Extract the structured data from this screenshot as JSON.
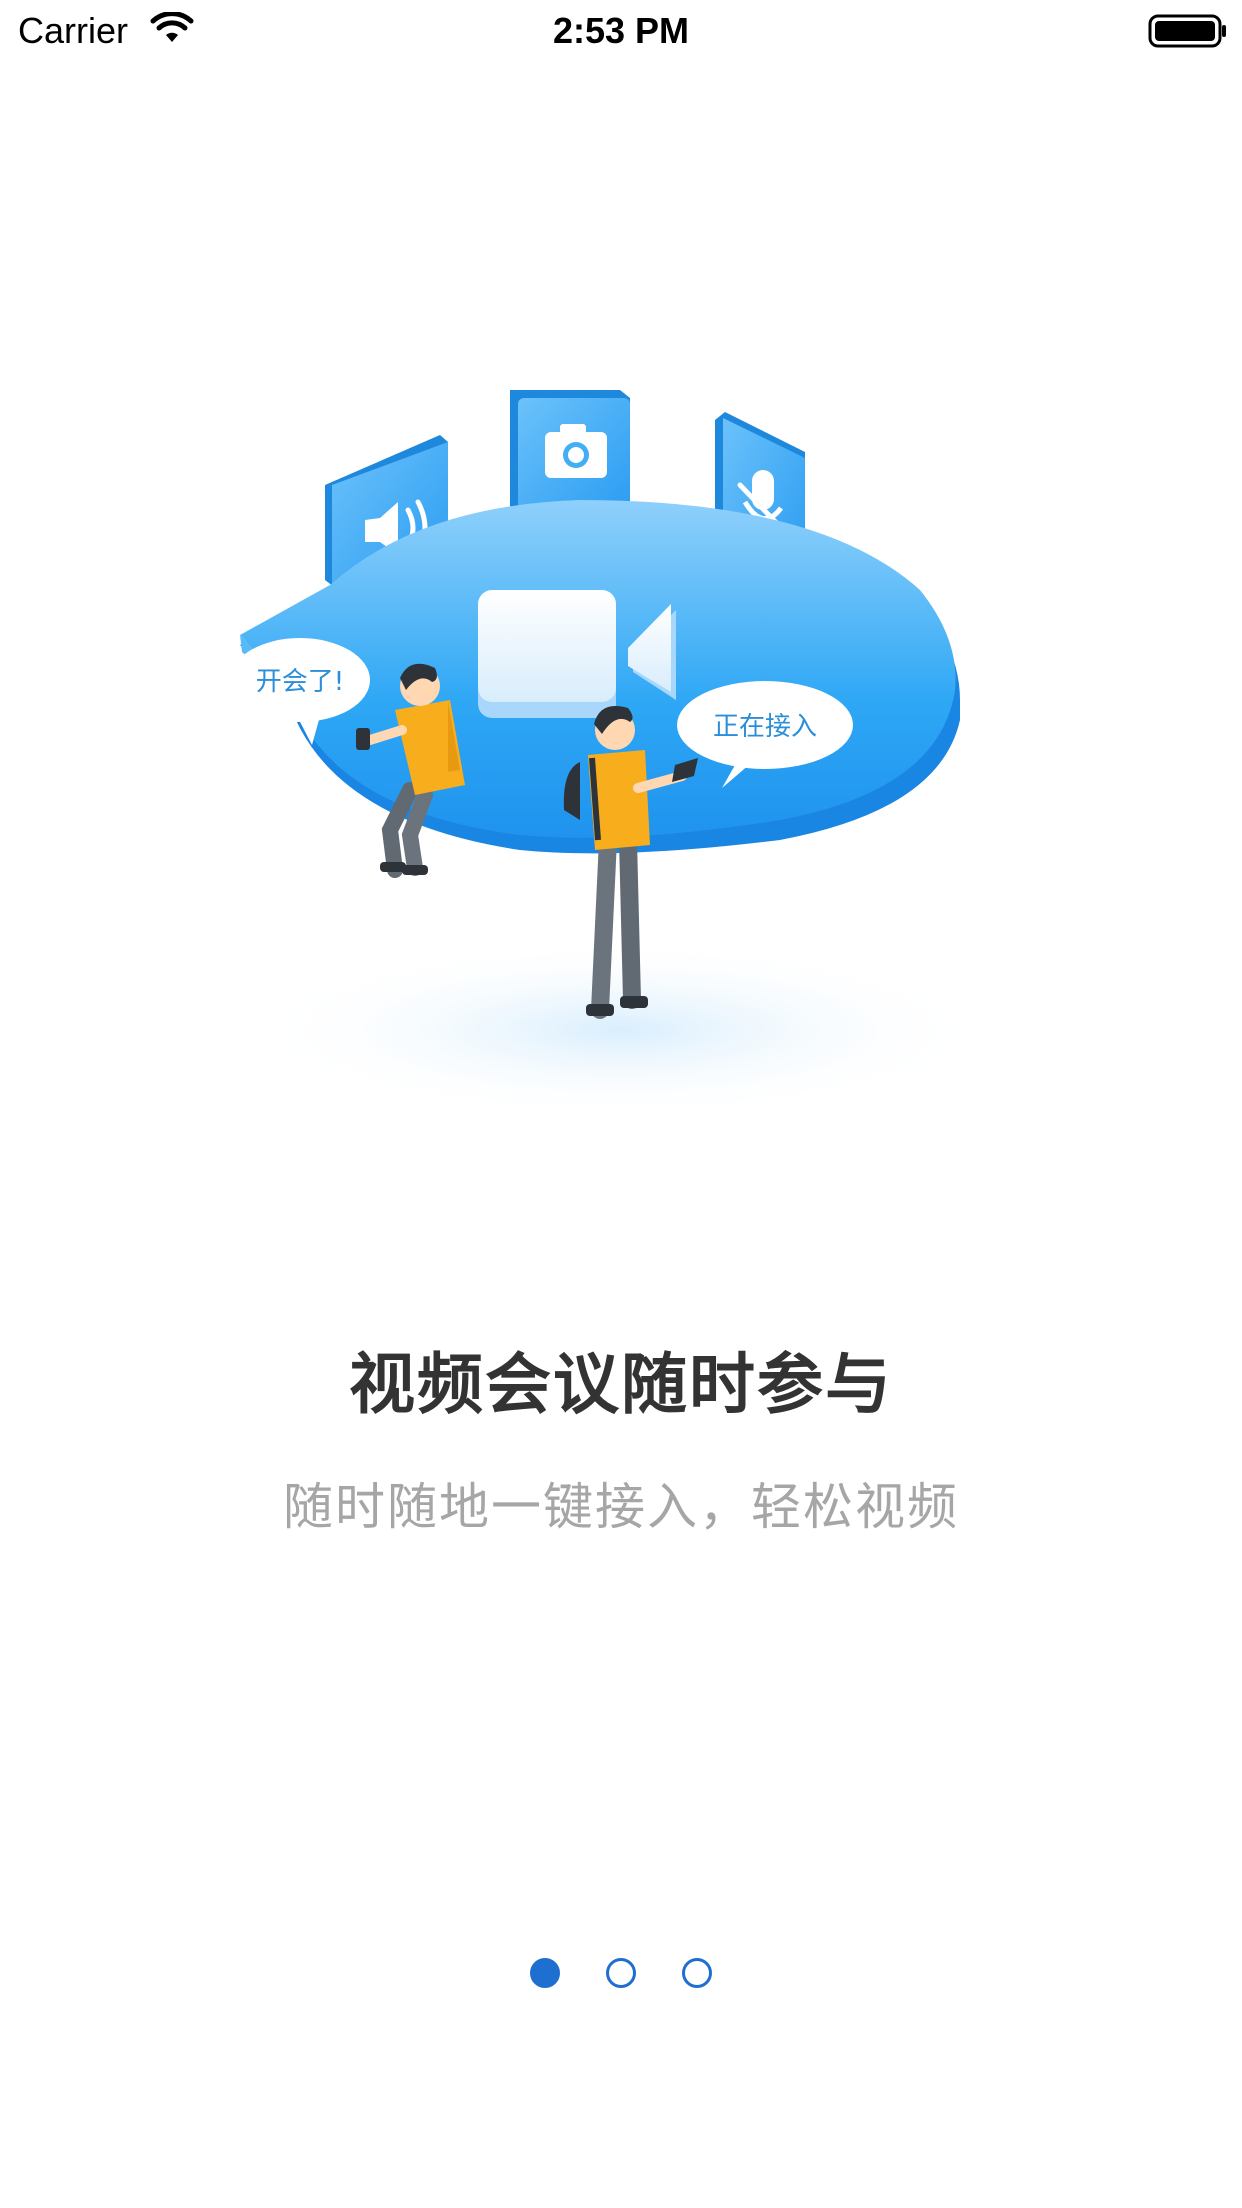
{
  "status_bar": {
    "carrier": "Carrier",
    "time": "2:53 PM",
    "wifi_icon": "wifi-icon",
    "battery_icon": "battery-full-icon"
  },
  "illustration": {
    "bubble_left": "开会了!",
    "bubble_right": "正在接入",
    "icons": [
      "speaker-icon",
      "camera-icon",
      "mic-muted-icon",
      "video-camera-icon"
    ]
  },
  "onboarding": {
    "title": "视频会议随时参与",
    "subtitle": "随时随地一键接入，轻松视频"
  },
  "pager": {
    "pages": 3,
    "active_index": 0,
    "accent_color": "#1f6fd0"
  },
  "colors": {
    "brand_blue": "#2ea7f5",
    "shirt_yellow": "#f8ad1c",
    "title_text": "#333333",
    "subtitle_text": "#a6a6a6"
  }
}
